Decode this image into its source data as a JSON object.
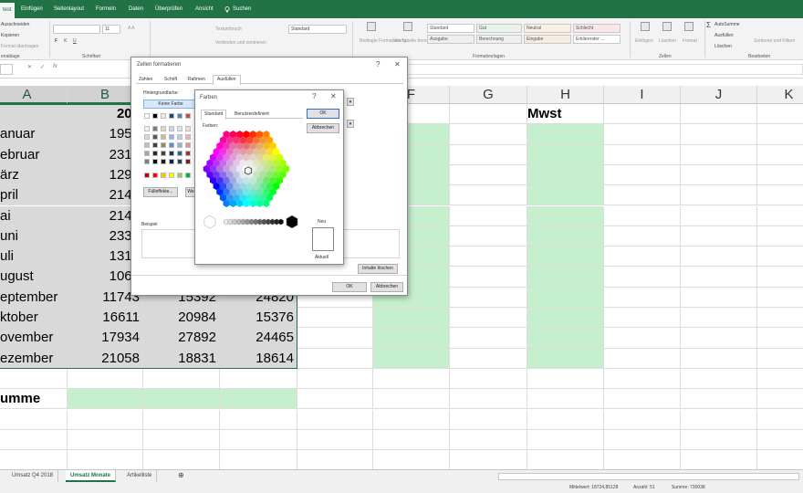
{
  "ribbon": {
    "tabs": [
      "test",
      "Einfügen",
      "Seitenlayout",
      "Formeln",
      "Daten",
      "Überprüfen",
      "Ansicht",
      "Suchen"
    ],
    "clipboard": {
      "cut": "Ausschneiden",
      "copy": "Kopieren",
      "format": "Format übertragen",
      "group": "enablage"
    },
    "font": {
      "name": "",
      "size": "11",
      "group": "Schriftart"
    },
    "alignment": {
      "wrap": "Textumbruch",
      "merge": "Verbinden und zentrieren"
    },
    "number": {
      "format": "Standard"
    },
    "styles": {
      "cond": "Bedingte Formatierung",
      "table": "Als Tabelle formatieren",
      "cells": [
        "Standard",
        "Gut",
        "Neutral",
        "Schlecht",
        "Ausgabe",
        "Berechnung",
        "Eingabe",
        "Erklärender ..."
      ],
      "group": "Formatvorlagen"
    },
    "cells_group": {
      "insert": "Einfügen",
      "delete": "Löschen",
      "format": "Format",
      "group": "Zellen"
    },
    "editing": {
      "autosum": "AutoSumme",
      "fill": "Ausfüllen",
      "clear": "Löschen",
      "sort": "Sortieren und Filtern",
      "group": "Bearbeiten"
    }
  },
  "formula_bar": {
    "name_box": "",
    "cancel": "✕",
    "confirm": "✓",
    "fx": "fx"
  },
  "grid": {
    "columns": [
      "A",
      "B",
      "C",
      "D",
      "E",
      "F",
      "G",
      "H",
      "I",
      "J",
      "K"
    ],
    "header_b": "201",
    "header_e": "me",
    "header_h": "Mwst",
    "months": [
      "anuar",
      "ebruar",
      "ärz",
      "pril",
      "ai",
      "uni",
      "uli",
      "ugust",
      "eptember",
      "ktober",
      "ovember",
      "ezember"
    ],
    "values_b": [
      1957,
      2312,
      1293,
      2145,
      2146,
      2333,
      1316,
      1069,
      11743,
      16611,
      17934,
      21058
    ],
    "values_c": [
      "",
      "",
      "",
      "",
      "",
      "",
      "",
      "",
      "15392",
      "20984",
      "27892",
      "18831"
    ],
    "values_d": [
      "",
      "",
      "",
      "",
      "",
      "",
      "",
      "",
      "24820",
      "15376",
      "24465",
      "18614"
    ],
    "summe_label": "umme"
  },
  "sheet_tabs": [
    "Umsatz Q4 2018",
    "Umsatz Monate",
    "Artikelliste"
  ],
  "status": {
    "mittelwert": "Mittelwert: 18724,85128",
    "anzahl": "Anzahl: 51",
    "summe": "Summe: 730038"
  },
  "format_dialog": {
    "title": "Zellen formatieren",
    "tabs": [
      "Zahlen",
      "Schrift",
      "Rahmen",
      "Ausfüllen"
    ],
    "bg_label": "Hintergrundfarbe:",
    "no_color": "Keine Farbe",
    "fill_effects": "Fülleffekte...",
    "more_colors": "We",
    "sample": "Beispiel",
    "clear": "Inhalte löschen",
    "ok": "OK",
    "cancel": "Abbrechen"
  },
  "colors_dialog": {
    "title": "Farben",
    "help": "?",
    "tabs": [
      "Standard",
      "Benutzerdefiniert"
    ],
    "colors_label": "Farben:",
    "ok": "OK",
    "cancel": "Abbrechen",
    "new_label": "Neu",
    "current_label": "Aktuell"
  },
  "colors": {
    "excel_green": "#217346",
    "highlight_green": "#c6efce",
    "selection_gray": "#d9d9d9"
  }
}
